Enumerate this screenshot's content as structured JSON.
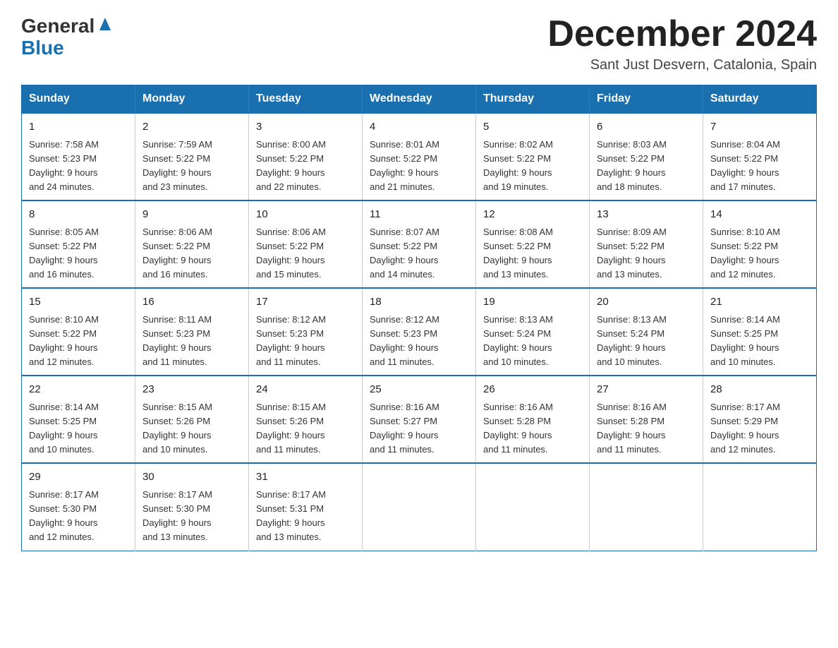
{
  "header": {
    "logo_general": "General",
    "logo_blue": "Blue",
    "month_title": "December 2024",
    "location": "Sant Just Desvern, Catalonia, Spain"
  },
  "calendar": {
    "headers": [
      "Sunday",
      "Monday",
      "Tuesday",
      "Wednesday",
      "Thursday",
      "Friday",
      "Saturday"
    ],
    "weeks": [
      [
        {
          "day": "1",
          "info": "Sunrise: 7:58 AM\nSunset: 5:23 PM\nDaylight: 9 hours\nand 24 minutes."
        },
        {
          "day": "2",
          "info": "Sunrise: 7:59 AM\nSunset: 5:22 PM\nDaylight: 9 hours\nand 23 minutes."
        },
        {
          "day": "3",
          "info": "Sunrise: 8:00 AM\nSunset: 5:22 PM\nDaylight: 9 hours\nand 22 minutes."
        },
        {
          "day": "4",
          "info": "Sunrise: 8:01 AM\nSunset: 5:22 PM\nDaylight: 9 hours\nand 21 minutes."
        },
        {
          "day": "5",
          "info": "Sunrise: 8:02 AM\nSunset: 5:22 PM\nDaylight: 9 hours\nand 19 minutes."
        },
        {
          "day": "6",
          "info": "Sunrise: 8:03 AM\nSunset: 5:22 PM\nDaylight: 9 hours\nand 18 minutes."
        },
        {
          "day": "7",
          "info": "Sunrise: 8:04 AM\nSunset: 5:22 PM\nDaylight: 9 hours\nand 17 minutes."
        }
      ],
      [
        {
          "day": "8",
          "info": "Sunrise: 8:05 AM\nSunset: 5:22 PM\nDaylight: 9 hours\nand 16 minutes."
        },
        {
          "day": "9",
          "info": "Sunrise: 8:06 AM\nSunset: 5:22 PM\nDaylight: 9 hours\nand 16 minutes."
        },
        {
          "day": "10",
          "info": "Sunrise: 8:06 AM\nSunset: 5:22 PM\nDaylight: 9 hours\nand 15 minutes."
        },
        {
          "day": "11",
          "info": "Sunrise: 8:07 AM\nSunset: 5:22 PM\nDaylight: 9 hours\nand 14 minutes."
        },
        {
          "day": "12",
          "info": "Sunrise: 8:08 AM\nSunset: 5:22 PM\nDaylight: 9 hours\nand 13 minutes."
        },
        {
          "day": "13",
          "info": "Sunrise: 8:09 AM\nSunset: 5:22 PM\nDaylight: 9 hours\nand 13 minutes."
        },
        {
          "day": "14",
          "info": "Sunrise: 8:10 AM\nSunset: 5:22 PM\nDaylight: 9 hours\nand 12 minutes."
        }
      ],
      [
        {
          "day": "15",
          "info": "Sunrise: 8:10 AM\nSunset: 5:22 PM\nDaylight: 9 hours\nand 12 minutes."
        },
        {
          "day": "16",
          "info": "Sunrise: 8:11 AM\nSunset: 5:23 PM\nDaylight: 9 hours\nand 11 minutes."
        },
        {
          "day": "17",
          "info": "Sunrise: 8:12 AM\nSunset: 5:23 PM\nDaylight: 9 hours\nand 11 minutes."
        },
        {
          "day": "18",
          "info": "Sunrise: 8:12 AM\nSunset: 5:23 PM\nDaylight: 9 hours\nand 11 minutes."
        },
        {
          "day": "19",
          "info": "Sunrise: 8:13 AM\nSunset: 5:24 PM\nDaylight: 9 hours\nand 10 minutes."
        },
        {
          "day": "20",
          "info": "Sunrise: 8:13 AM\nSunset: 5:24 PM\nDaylight: 9 hours\nand 10 minutes."
        },
        {
          "day": "21",
          "info": "Sunrise: 8:14 AM\nSunset: 5:25 PM\nDaylight: 9 hours\nand 10 minutes."
        }
      ],
      [
        {
          "day": "22",
          "info": "Sunrise: 8:14 AM\nSunset: 5:25 PM\nDaylight: 9 hours\nand 10 minutes."
        },
        {
          "day": "23",
          "info": "Sunrise: 8:15 AM\nSunset: 5:26 PM\nDaylight: 9 hours\nand 10 minutes."
        },
        {
          "day": "24",
          "info": "Sunrise: 8:15 AM\nSunset: 5:26 PM\nDaylight: 9 hours\nand 11 minutes."
        },
        {
          "day": "25",
          "info": "Sunrise: 8:16 AM\nSunset: 5:27 PM\nDaylight: 9 hours\nand 11 minutes."
        },
        {
          "day": "26",
          "info": "Sunrise: 8:16 AM\nSunset: 5:28 PM\nDaylight: 9 hours\nand 11 minutes."
        },
        {
          "day": "27",
          "info": "Sunrise: 8:16 AM\nSunset: 5:28 PM\nDaylight: 9 hours\nand 11 minutes."
        },
        {
          "day": "28",
          "info": "Sunrise: 8:17 AM\nSunset: 5:29 PM\nDaylight: 9 hours\nand 12 minutes."
        }
      ],
      [
        {
          "day": "29",
          "info": "Sunrise: 8:17 AM\nSunset: 5:30 PM\nDaylight: 9 hours\nand 12 minutes."
        },
        {
          "day": "30",
          "info": "Sunrise: 8:17 AM\nSunset: 5:30 PM\nDaylight: 9 hours\nand 13 minutes."
        },
        {
          "day": "31",
          "info": "Sunrise: 8:17 AM\nSunset: 5:31 PM\nDaylight: 9 hours\nand 13 minutes."
        },
        {
          "day": "",
          "info": ""
        },
        {
          "day": "",
          "info": ""
        },
        {
          "day": "",
          "info": ""
        },
        {
          "day": "",
          "info": ""
        }
      ]
    ]
  }
}
